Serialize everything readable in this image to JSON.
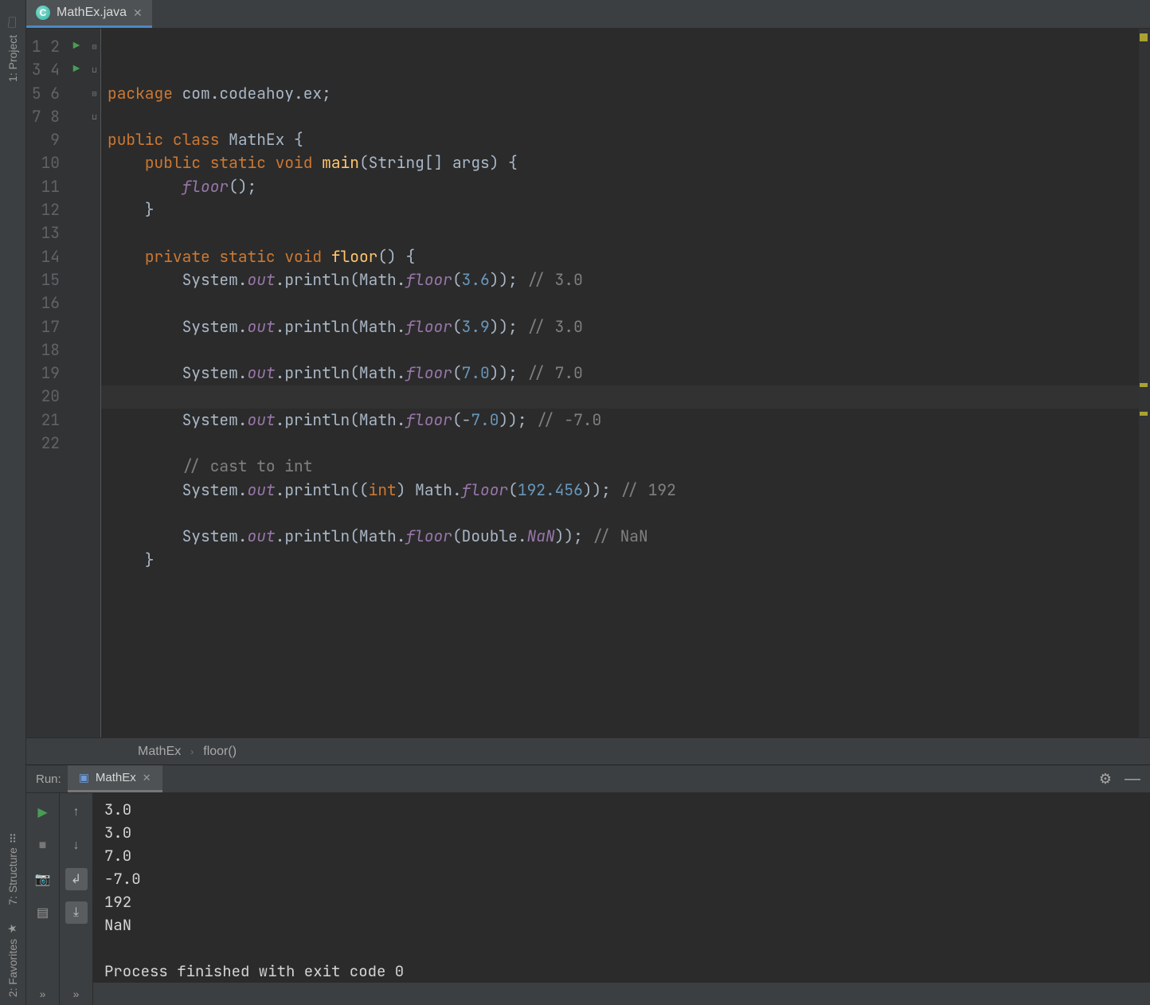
{
  "tab": {
    "filename": "MathEx.java",
    "icon_letter": "C"
  },
  "leftRail": {
    "project": "1: Project",
    "structure": "7: Structure",
    "favorites": "2: Favorites"
  },
  "breadcrumb": {
    "a": "MathEx",
    "b": "floor()"
  },
  "gutter": {
    "lines": [
      "1",
      "2",
      "3",
      "4",
      "5",
      "6",
      "7",
      "8",
      "9",
      "10",
      "11",
      "12",
      "13",
      "14",
      "15",
      "16",
      "17",
      "18",
      "19",
      "20",
      "21",
      "22"
    ],
    "runMarkers": [
      3,
      4
    ],
    "foldMarkers": {
      "4": "⊟",
      "6": "⊔",
      "8": "⊟",
      "21": "⊔"
    }
  },
  "code": {
    "l1": {
      "pkg": "package",
      "name": "com.codeahoy.ex"
    },
    "l3": {
      "pub": "public",
      "cls": "class",
      "name": "MathEx"
    },
    "l4": {
      "pub": "public",
      "stat": "static",
      "vd": "void",
      "name": "main",
      "sig": "(String[] args) {"
    },
    "l5": {
      "call": "floor",
      "tail": "();"
    },
    "l6": {
      "brace": "}"
    },
    "l8": {
      "priv": "private",
      "stat": "static",
      "vd": "void",
      "name": "floor",
      "tail": "() {"
    },
    "print": {
      "sys": "System.",
      "out": "out",
      "dot": ".",
      "print": "println",
      "open": "(Math.",
      "floor": "floor",
      "po": "(",
      "pc": ")",
      "end": ");"
    },
    "l9": {
      "arg": "3.6",
      "cmt": "// 3.0"
    },
    "l11": {
      "arg": "3.9",
      "cmt": "// 3.0"
    },
    "l13": {
      "arg": "7.0",
      "cmt": "// 7.0"
    },
    "l15": {
      "pre": "-",
      "arg": "7.0",
      "cmt": "// -7.0"
    },
    "l17": {
      "cmt": "// cast to int"
    },
    "l18": {
      "cast_open": "((",
      "cast": "int",
      "cast_close": ") Math.",
      "arg": "192.456",
      "cmt": "// 192"
    },
    "l20": {
      "dbl": "Double.",
      "nan": "NaN",
      "cmt": "// NaN"
    },
    "l21": {
      "brace": "}"
    }
  },
  "run": {
    "label": "Run:",
    "tab": "MathEx",
    "output": [
      "3.0",
      "3.0",
      "7.0",
      "-7.0",
      "192",
      "NaN",
      "",
      "Process finished with exit code 0"
    ]
  }
}
